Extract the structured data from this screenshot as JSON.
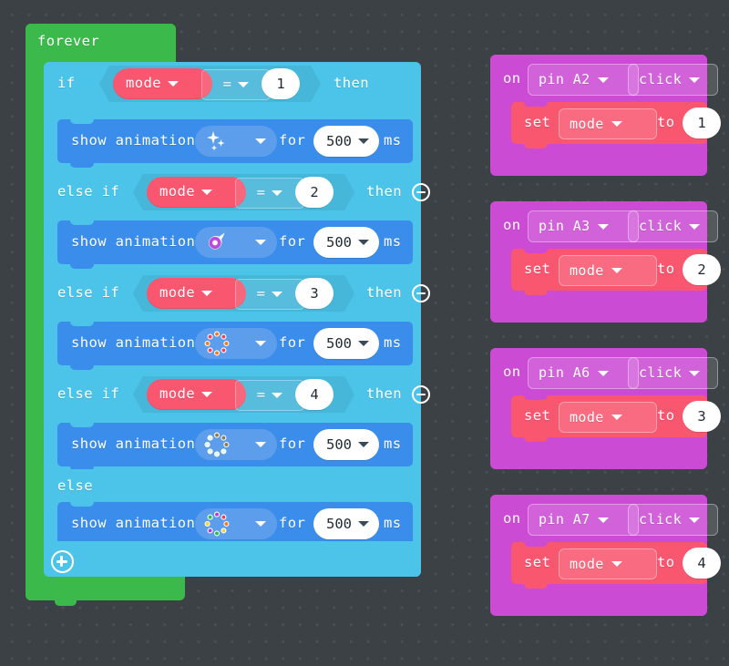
{
  "workspace": {
    "background_color": "#3c4146",
    "grid_dot_color": "#4a5057"
  },
  "colors": {
    "loop_green": "#3cb94b",
    "logic_cyan": "#4cc3e8",
    "animation_blue": "#3a8dea",
    "variable_red": "#f9566f",
    "event_purple": "#cc4bd4",
    "field_white": "#ffffff"
  },
  "forever_stack": {
    "hat_label": "forever",
    "conditional": {
      "if_label": "if",
      "else_if_label": "else if",
      "else_label": "else",
      "then_label": "then",
      "add_branch_icon": "plus-circle-icon",
      "remove_branch_icon": "minus-circle-icon",
      "branches": [
        {
          "keyword": "if",
          "variable": "mode",
          "operator": "=",
          "value": "1",
          "has_remove": false,
          "statement": {
            "label": "show animation",
            "animation": "sparkle-animation",
            "for_label": "for",
            "duration": "500",
            "unit_label": "ms"
          }
        },
        {
          "keyword": "else if",
          "variable": "mode",
          "operator": "=",
          "value": "2",
          "has_remove": true,
          "statement": {
            "label": "show animation",
            "animation": "comet-animation",
            "for_label": "for",
            "duration": "500",
            "unit_label": "ms"
          }
        },
        {
          "keyword": "else if",
          "variable": "mode",
          "operator": "=",
          "value": "3",
          "has_remove": true,
          "statement": {
            "label": "show animation",
            "animation": "warm-ring-animation",
            "for_label": "for",
            "duration": "500",
            "unit_label": "ms"
          }
        },
        {
          "keyword": "else if",
          "variable": "mode",
          "operator": "=",
          "value": "4",
          "has_remove": true,
          "statement": {
            "label": "show animation",
            "animation": "chase-ring-animation",
            "for_label": "for",
            "duration": "500",
            "unit_label": "ms"
          }
        }
      ],
      "else_branch": {
        "keyword": "else",
        "statement": {
          "label": "show animation",
          "animation": "rainbow-ring-animation",
          "for_label": "for",
          "duration": "500",
          "unit_label": "ms"
        }
      }
    }
  },
  "event_stacks": [
    {
      "on_label": "on",
      "pin": "pin A2",
      "gesture": "click",
      "body": {
        "set_label": "set",
        "variable": "mode",
        "to_label": "to",
        "value": "1"
      }
    },
    {
      "on_label": "on",
      "pin": "pin A3",
      "gesture": "click",
      "body": {
        "set_label": "set",
        "variable": "mode",
        "to_label": "to",
        "value": "2"
      }
    },
    {
      "on_label": "on",
      "pin": "pin A6",
      "gesture": "click",
      "body": {
        "set_label": "set",
        "variable": "mode",
        "to_label": "to",
        "value": "3"
      }
    },
    {
      "on_label": "on",
      "pin": "pin A7",
      "gesture": "click",
      "body": {
        "set_label": "set",
        "variable": "mode",
        "to_label": "to",
        "value": "4"
      }
    }
  ]
}
